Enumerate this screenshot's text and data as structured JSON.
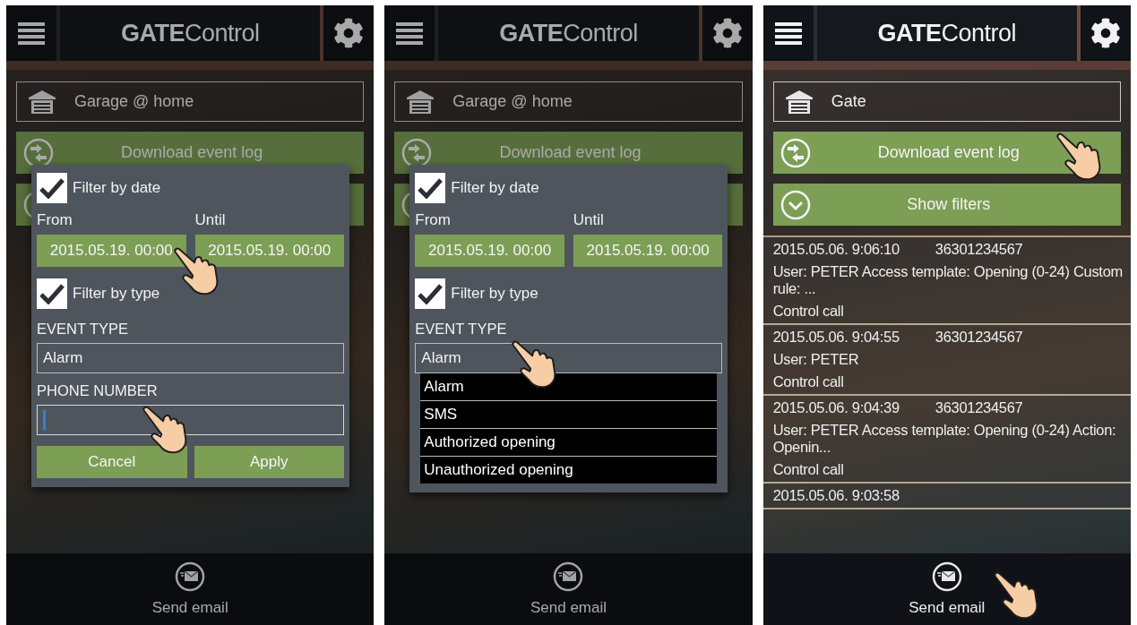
{
  "phones": [
    {
      "title": "**GATE**Control",
      "device": "Garage @ home",
      "actions": [
        {
          "kind": "download",
          "label": "Download event log",
          "touched": false
        },
        {
          "kind": "filters",
          "touched": false
        }
      ],
      "dialog": {
        "date_filter": {
          "label": "Filter by date",
          "checked": true
        },
        "from_label": "From",
        "until_label": "Until",
        "from": {
          "value": "2015.05.19. 00:00",
          "touched": true
        },
        "until": {
          "value": "2015.05.19. 00:00",
          "touched": false
        },
        "type_filter": {
          "label": "Filter by type",
          "checked": true
        },
        "event_type_label": "EVENT TYPE",
        "event_type": {
          "value": "Alarm",
          "touched": false
        },
        "phone_label": "PHONE NUMBER",
        "phone_field": {
          "focused": true,
          "touched": true
        },
        "buttons": [
          "Cancel",
          "Apply"
        ]
      },
      "footer": {
        "label": "Send email",
        "touched": false
      }
    },
    {
      "title": "**GATE**Control",
      "device": "Garage @ home",
      "actions": [
        {
          "kind": "download",
          "label": "Download event log",
          "touched": false
        },
        {
          "kind": "filters",
          "touched": false
        }
      ],
      "dialog": {
        "date_filter": {
          "label": "Filter by date",
          "checked": true
        },
        "from_label": "From",
        "until_label": "Until",
        "from": {
          "value": "2015.05.19. 00:00",
          "touched": false
        },
        "until": {
          "value": "2015.05.19. 00:00",
          "touched": false
        },
        "type_filter": {
          "label": "Filter by type",
          "checked": true
        },
        "event_type_label": "EVENT TYPE",
        "event_type": {
          "value": "Alarm",
          "touched": true
        },
        "dropdown": [
          "Alarm",
          "SMS",
          "Authorized opening",
          "Unauthorized opening"
        ]
      },
      "footer": {
        "label": "Send email",
        "touched": false
      }
    },
    {
      "title": "**GATE**Control",
      "device": "Gate",
      "actions": [
        {
          "kind": "download",
          "label": "Download event log",
          "touched": true
        },
        {
          "kind": "filters",
          "label": "Show filters",
          "touched": false
        }
      ],
      "log": [
        {
          "time": "2015.05.06. 9:06:10",
          "number": "36301234567",
          "details": "User: PETER Access template: Opening (0-24) Custom rule:  ...",
          "type": "Control call"
        },
        {
          "time": "2015.05.06. 9:04:55",
          "number": "36301234567",
          "details": "User: PETER",
          "type": "Control call"
        },
        {
          "time": "2015.05.06. 9:04:39",
          "number": "36301234567",
          "details": "User: PETER Access template: Opening (0-24) Action: Openin...",
          "type": "Control call"
        },
        {
          "time": "2015.05.06. 9:03:58"
        }
      ],
      "footer": {
        "label": "Send email",
        "touched": true
      }
    }
  ]
}
